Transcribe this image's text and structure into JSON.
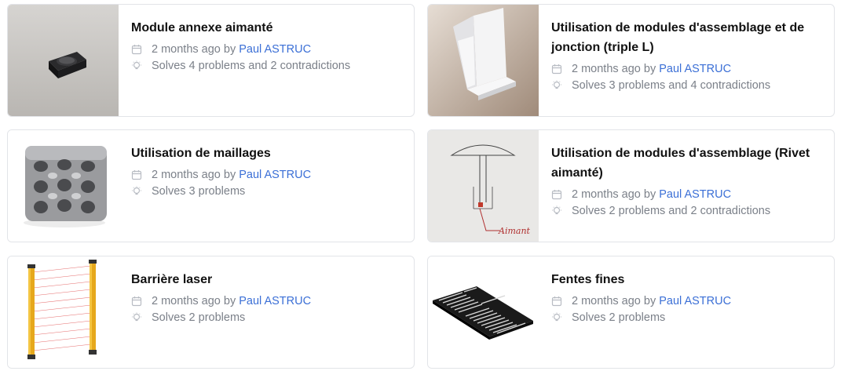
{
  "cards": [
    {
      "title": "Module annexe aimanté",
      "date": "2 months ago by",
      "author": "Paul ASTRUC",
      "solves": "Solves 4 problems and 2 contradictions",
      "image": "magnetic-module-photo"
    },
    {
      "title": "Utilisation de modules d'assemblage et de jonction (triple L)",
      "date": "2 months ago by",
      "author": "Paul ASTRUC",
      "solves": "Solves 3 problems and 4 contradictions",
      "image": "triple-l-joint-photo"
    },
    {
      "title": "Utilisation de maillages",
      "date": "2 months ago by",
      "author": "Paul ASTRUC",
      "solves": "Solves 3 problems",
      "image": "gyroid-lattice-photo"
    },
    {
      "title": "Utilisation de modules d'assemblage (Rivet aimanté)",
      "date": "2 months ago by",
      "author": "Paul ASTRUC",
      "solves": "Solves 2 problems and 2 contradictions",
      "image": "rivet-sketch",
      "sketch_label": "Aimant"
    },
    {
      "title": "Barrière laser",
      "date": "2 months ago by",
      "author": "Paul ASTRUC",
      "solves": "Solves 2 problems",
      "image": "laser-barrier-photo"
    },
    {
      "title": "Fentes fines",
      "date": "2 months ago by",
      "author": "Paul ASTRUC",
      "solves": "Solves 2 problems",
      "image": "thin-slots-render"
    }
  ],
  "colors": {
    "author_link": "#3b6fd6",
    "meta_text": "#7b8089",
    "border": "#e2e4e8"
  },
  "icons": {
    "date": "calendar-icon",
    "solves": "lightbulb-icon"
  }
}
